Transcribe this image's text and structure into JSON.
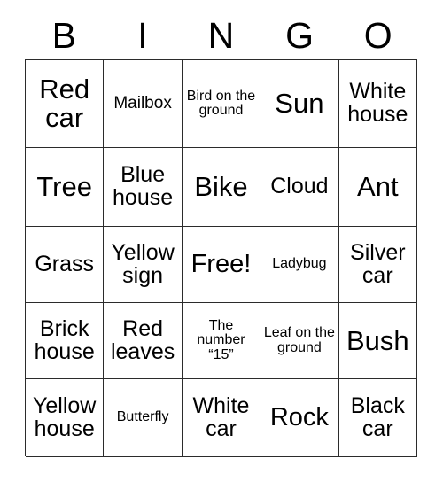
{
  "card": {
    "header_letters": [
      "B",
      "I",
      "N",
      "G",
      "O"
    ],
    "border_color": "#2b2b2b",
    "background_color": "#ffffff",
    "text_color": "#000000",
    "rows": [
      [
        {
          "text": "Red car",
          "size": "fs-xl"
        },
        {
          "text": "Mailbox",
          "size": "fs-sm"
        },
        {
          "text": "Bird on the ground",
          "size": "fs-xs"
        },
        {
          "text": "Sun",
          "size": "fs-xl"
        },
        {
          "text": "White house",
          "size": "fs-md"
        }
      ],
      [
        {
          "text": "Tree",
          "size": "fs-xl"
        },
        {
          "text": "Blue house",
          "size": "fs-md"
        },
        {
          "text": "Bike",
          "size": "fs-xl"
        },
        {
          "text": "Cloud",
          "size": "fs-md"
        },
        {
          "text": "Ant",
          "size": "fs-xl"
        }
      ],
      [
        {
          "text": "Grass",
          "size": "fs-md"
        },
        {
          "text": "Yellow sign",
          "size": "fs-md"
        },
        {
          "text": "Free!",
          "size": "fs-lg"
        },
        {
          "text": "Ladybug",
          "size": "fs-xs"
        },
        {
          "text": "Silver car",
          "size": "fs-md"
        }
      ],
      [
        {
          "text": "Brick house",
          "size": "fs-md"
        },
        {
          "text": "Red leaves",
          "size": "fs-md"
        },
        {
          "text": "The number “15”",
          "size": "fs-xs"
        },
        {
          "text": "Leaf on the ground",
          "size": "fs-xs"
        },
        {
          "text": "Bush",
          "size": "fs-xl"
        }
      ],
      [
        {
          "text": "Yellow house",
          "size": "fs-md"
        },
        {
          "text": "Butterfly",
          "size": "fs-xs"
        },
        {
          "text": "White car",
          "size": "fs-md"
        },
        {
          "text": "Rock",
          "size": "fs-lg"
        },
        {
          "text": "Black car",
          "size": "fs-md"
        }
      ]
    ]
  }
}
